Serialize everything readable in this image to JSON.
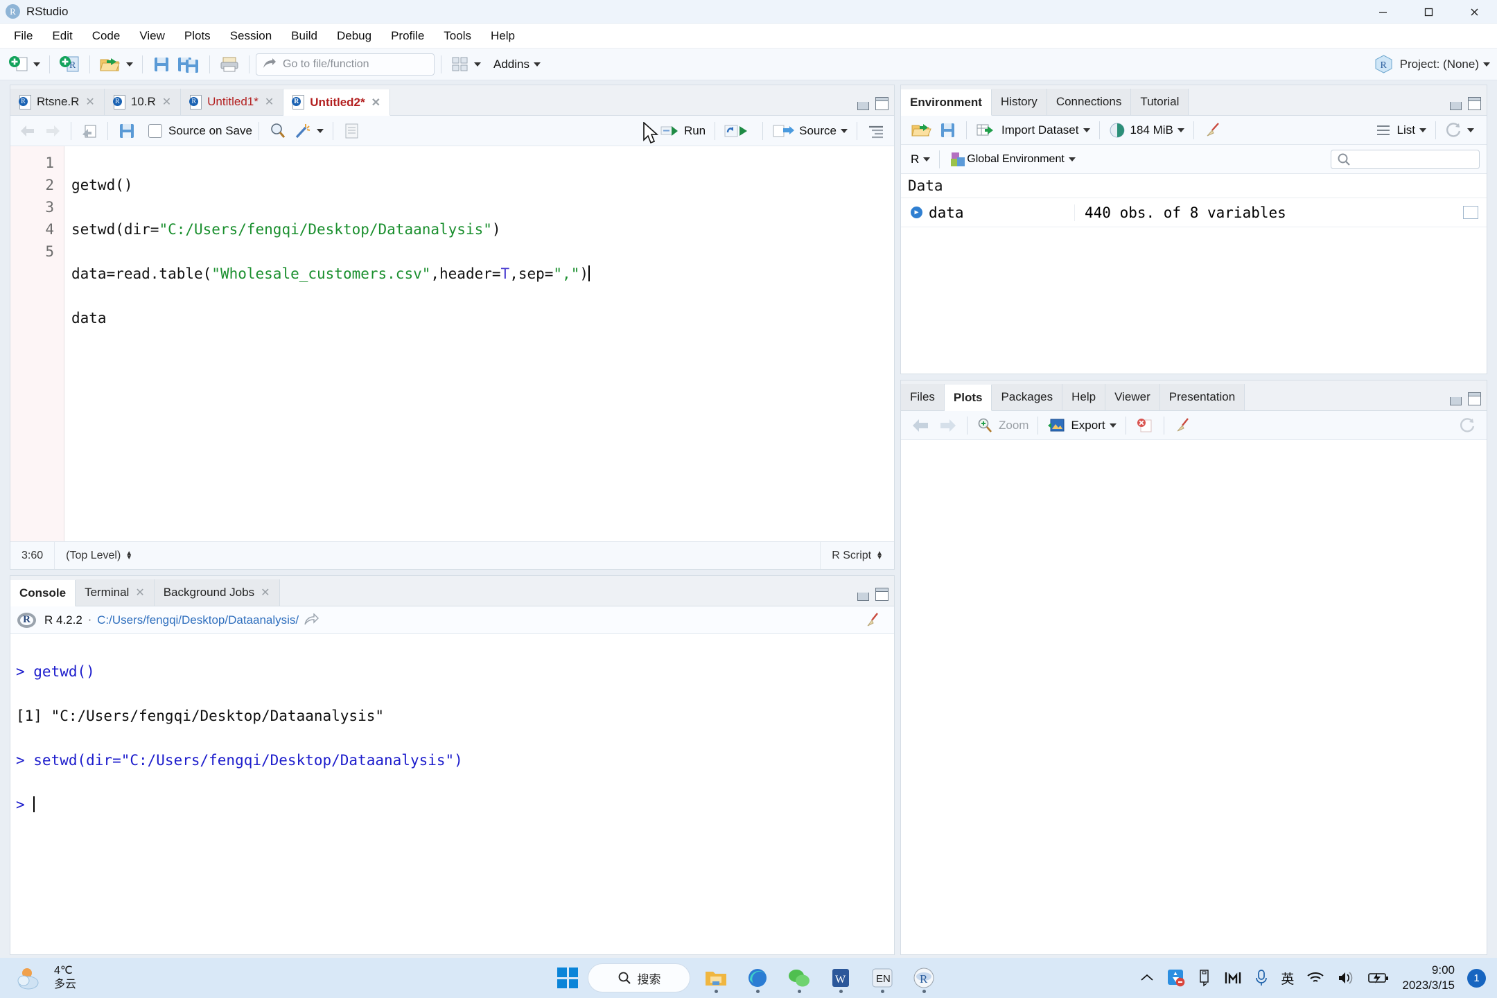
{
  "window": {
    "title": "RStudio",
    "app_icon": "R",
    "minimize": "–",
    "maximize": "▢",
    "close": "✕"
  },
  "menubar": {
    "items": [
      "File",
      "Edit",
      "Code",
      "View",
      "Plots",
      "Session",
      "Build",
      "Debug",
      "Profile",
      "Tools",
      "Help"
    ]
  },
  "toolbar": {
    "goto_placeholder": "Go to file/function",
    "addins_label": "Addins",
    "project_label": "Project: (None)"
  },
  "editor": {
    "tabs": [
      {
        "label": "Rtsne.R",
        "modified": false,
        "active": false
      },
      {
        "label": "10.R",
        "modified": false,
        "active": false
      },
      {
        "label": "Untitled1*",
        "modified": true,
        "active": false
      },
      {
        "label": "Untitled2*",
        "modified": true,
        "active": true
      }
    ],
    "toolbar": {
      "source_on_save": "Source on Save",
      "run_label": "Run",
      "source_label": "Source"
    },
    "line_numbers": [
      "1",
      "2",
      "3",
      "4",
      "5"
    ],
    "lines": [
      {
        "plain": "getwd()"
      },
      {
        "plain": "setwd(dir=\"C:/Users/fengqi/Desktop/Dataanalysis\")"
      },
      {
        "plain": "data=read.table(\"Wholesale_customers.csv\",header=T,sep=\",\")"
      },
      {
        "plain": "data"
      },
      {
        "plain": ""
      }
    ],
    "status": {
      "position": "3:60",
      "scope": "(Top Level)",
      "filetype": "R Script"
    }
  },
  "console": {
    "tabs": [
      {
        "label": "Console",
        "closable": false,
        "active": true
      },
      {
        "label": "Terminal",
        "closable": true,
        "active": false
      },
      {
        "label": "Background Jobs",
        "closable": true,
        "active": false
      }
    ],
    "r_version": "R 4.2.2",
    "separator": "·",
    "working_dir": "C:/Users/fengqi/Desktop/Dataanalysis/",
    "output_lines": [
      {
        "type": "input",
        "text": "> getwd()"
      },
      {
        "type": "output",
        "text": "[1] \"C:/Users/fengqi/Desktop/Dataanalysis\""
      },
      {
        "type": "input",
        "text": "> setwd(dir=\"C:/Users/fengqi/Desktop/Dataanalysis\")"
      },
      {
        "type": "prompt",
        "text": "> "
      }
    ]
  },
  "environment": {
    "tabs": [
      {
        "label": "Environment",
        "active": true
      },
      {
        "label": "History",
        "active": false
      },
      {
        "label": "Connections",
        "active": false
      },
      {
        "label": "Tutorial",
        "active": false
      }
    ],
    "toolbar": {
      "import_dataset": "Import Dataset",
      "memory": "184 MiB",
      "view_mode": "List"
    },
    "language": "R",
    "scope": "Global Environment",
    "search_placeholder": "",
    "group_header": "Data",
    "rows": [
      {
        "name": "data",
        "value": "440 obs. of 8 variables"
      }
    ]
  },
  "plots": {
    "tabs": [
      {
        "label": "Files",
        "active": false
      },
      {
        "label": "Plots",
        "active": true
      },
      {
        "label": "Packages",
        "active": false
      },
      {
        "label": "Help",
        "active": false
      },
      {
        "label": "Viewer",
        "active": false
      },
      {
        "label": "Presentation",
        "active": false
      }
    ],
    "toolbar": {
      "zoom_label": "Zoom",
      "export_label": "Export"
    }
  },
  "taskbar": {
    "weather_temp": "4℃",
    "weather_desc": "多云",
    "search_label": "搜索",
    "ime_label": "英",
    "clock_time": "9:00",
    "clock_date": "2023/3/15",
    "notification_count": "1"
  },
  "colors": {
    "accent": "#1765c0",
    "string": "#1a8f2e",
    "keyword": "#4b3fd1",
    "console_input": "#1c1ccc",
    "taskbar": "#d9e8f7"
  }
}
